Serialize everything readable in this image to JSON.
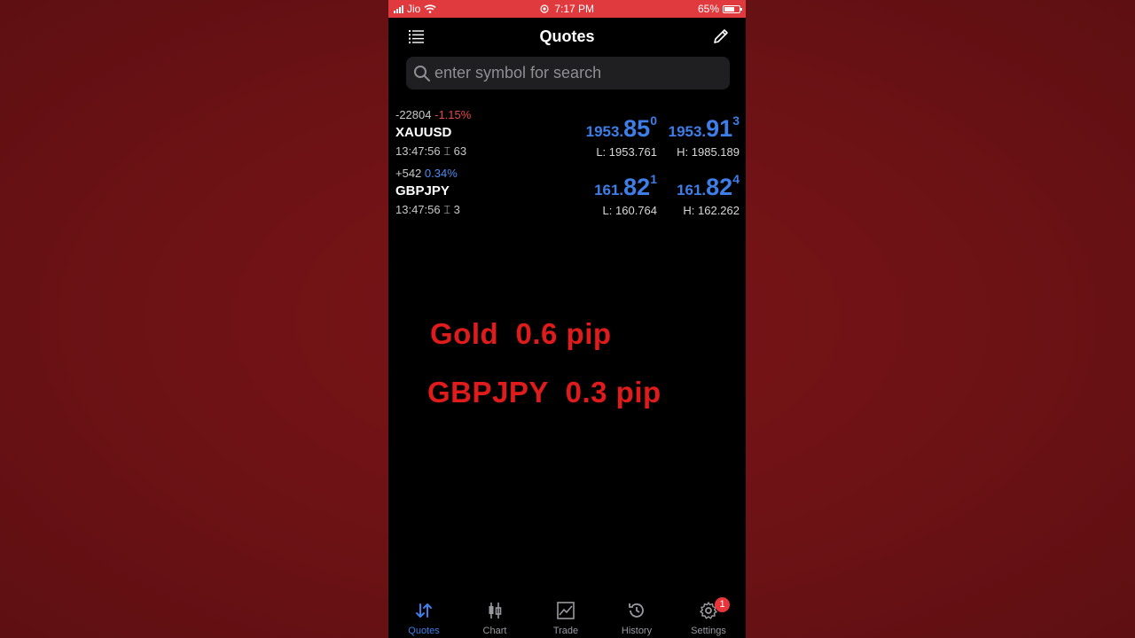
{
  "status_bar": {
    "carrier": "Jio",
    "time": "7:17 PM",
    "battery": "65%"
  },
  "header": {
    "title": "Quotes"
  },
  "search": {
    "placeholder": "enter symbol for search"
  },
  "quotes": [
    {
      "change": "-22804",
      "change_pct": "-1.15%",
      "symbol": "XAUUSD",
      "time": "13:47:56",
      "spread": "63",
      "bid": {
        "small": "1953.",
        "big": "85",
        "sup": "0"
      },
      "ask": {
        "small": "1953.",
        "big": "91",
        "sup": "3"
      },
      "low": "L: 1953.761",
      "high": "H: 1985.189"
    },
    {
      "change": "+542",
      "change_pct": "0.34%",
      "symbol": "GBPJPY",
      "time": "13:47:56",
      "spread": "3",
      "bid": {
        "small": "161.",
        "big": "82",
        "sup": "1"
      },
      "ask": {
        "small": "161.",
        "big": "82",
        "sup": "4"
      },
      "low": "L: 160.764",
      "high": "H: 162.262"
    }
  ],
  "overlay": {
    "line1": "Gold  0.6 pip",
    "line2": "GBPJPY  0.3 pip"
  },
  "tabs": [
    {
      "label": "Quotes",
      "icon": "arrows-updown-icon",
      "active": true
    },
    {
      "label": "Chart",
      "icon": "candlestick-icon",
      "active": false
    },
    {
      "label": "Trade",
      "icon": "line-chart-icon",
      "active": false
    },
    {
      "label": "History",
      "icon": "history-icon",
      "active": false
    },
    {
      "label": "Settings",
      "icon": "gear-icon",
      "active": false,
      "badge": "1"
    }
  ],
  "colors": {
    "accent": "#3d7ee8",
    "negative": "#e8474c",
    "overlay_text": "#e01b1b",
    "status_bar": "#e03a3e"
  }
}
